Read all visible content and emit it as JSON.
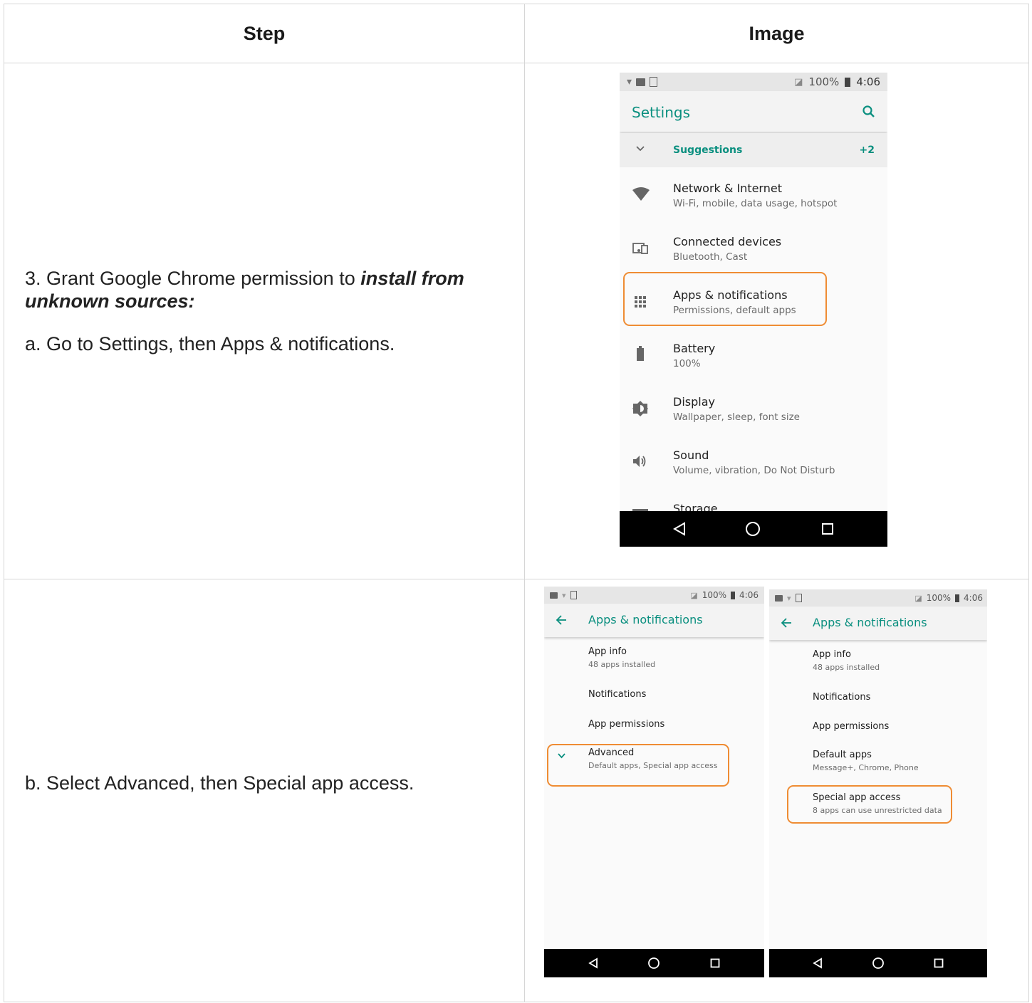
{
  "table": {
    "header_step": "Step",
    "header_image": "Image"
  },
  "row1": {
    "step_line1_prefix": "3. Grant Google Chrome permission to ",
    "step_line1_emph": "install from unknown sources:",
    "step_line2": "a. Go to Settings, then Apps & notifications.",
    "phone": {
      "status": {
        "battery": "100%",
        "time": "4:06"
      },
      "title": "Settings",
      "suggestions": {
        "label": "Suggestions",
        "count": "+2"
      },
      "items": [
        {
          "title": "Network & Internet",
          "subtitle": "Wi-Fi, mobile, data usage, hotspot",
          "icon": "wifi-icon"
        },
        {
          "title": "Connected devices",
          "subtitle": "Bluetooth, Cast",
          "icon": "devices-icon"
        },
        {
          "title": "Apps & notifications",
          "subtitle": "Permissions, default apps",
          "icon": "apps-grid-icon"
        },
        {
          "title": "Battery",
          "subtitle": "100%",
          "icon": "battery-icon"
        },
        {
          "title": "Display",
          "subtitle": "Wallpaper, sleep, font size",
          "icon": "brightness-icon"
        },
        {
          "title": "Sound",
          "subtitle": "Volume, vibration, Do Not Disturb",
          "icon": "volume-icon"
        },
        {
          "title": "Storage",
          "subtitle": "",
          "icon": "storage-icon"
        }
      ]
    }
  },
  "row2": {
    "step_text": "b. Select Advanced, then Special app access.",
    "phone_left": {
      "status": {
        "battery": "100%",
        "time": "4:06"
      },
      "title": "Apps & notifications",
      "items": [
        {
          "title": "App info",
          "subtitle": "48 apps installed"
        },
        {
          "title": "Notifications",
          "subtitle": ""
        },
        {
          "title": "App permissions",
          "subtitle": ""
        },
        {
          "title": "Advanced",
          "subtitle": "Default apps, Special app access"
        }
      ]
    },
    "phone_right": {
      "status": {
        "battery": "100%",
        "time": "4:06"
      },
      "title": "Apps & notifications",
      "items": [
        {
          "title": "App info",
          "subtitle": "48 apps installed"
        },
        {
          "title": "Notifications",
          "subtitle": ""
        },
        {
          "title": "App permissions",
          "subtitle": ""
        },
        {
          "title": "Default apps",
          "subtitle": "Message+, Chrome, Phone"
        },
        {
          "title": "Special app access",
          "subtitle": "8 apps can use unrestricted data"
        }
      ]
    }
  },
  "colors": {
    "accent": "#0a8f7f",
    "highlight": "#ef8c33",
    "navbar": "#000000"
  }
}
